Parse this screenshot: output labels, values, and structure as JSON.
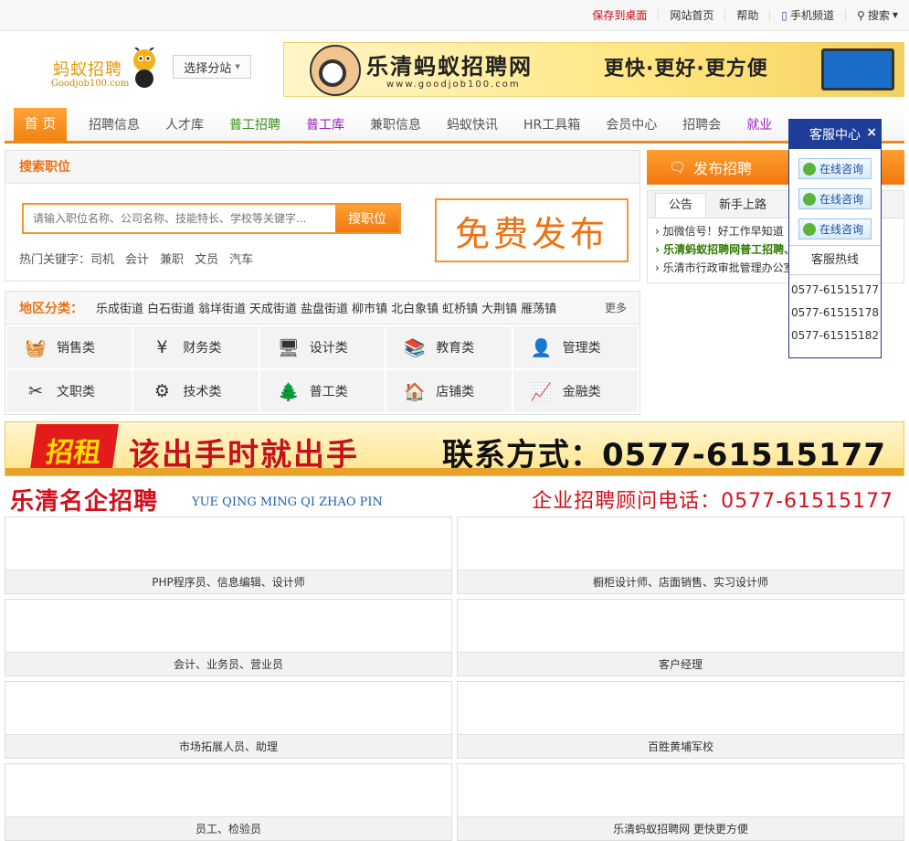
{
  "topbar": {
    "save_desktop": "保存到桌面",
    "home": "网站首页",
    "help": "帮助",
    "mobile": "手机频道",
    "search": "搜索"
  },
  "header": {
    "logo_text": "蚂蚁招聘",
    "logo_sub": "Goodjob100.com",
    "branch": "选择分站",
    "banner_title": "乐清蚂蚁招聘网",
    "banner_url": "www.goodjob100.com",
    "banner_slogan": "更快·更好·更方便"
  },
  "nav": [
    {
      "label": "首 页",
      "style": "home"
    },
    {
      "label": "招聘信息",
      "style": ""
    },
    {
      "label": "人才库",
      "style": ""
    },
    {
      "label": "普工招聘",
      "style": "green"
    },
    {
      "label": "普工库",
      "style": "purple"
    },
    {
      "label": "兼职信息",
      "style": ""
    },
    {
      "label": "蚂蚁快讯",
      "style": ""
    },
    {
      "label": "HR工具箱",
      "style": ""
    },
    {
      "label": "会员中心",
      "style": ""
    },
    {
      "label": "招聘会",
      "style": ""
    },
    {
      "label": "就业",
      "style": "purple"
    }
  ],
  "search": {
    "title": "搜索职位",
    "placeholder": "请输入职位名称、公司名称、技能特长、学校等关键字...",
    "button": "搜职位",
    "hot_label": "热门关键字：",
    "hot": [
      "司机",
      "会计",
      "兼职",
      "文员",
      "汽车"
    ],
    "free": "免费发布"
  },
  "area": {
    "title": "地区分类：",
    "districts": [
      "乐成街道",
      "白石街道",
      "翁垟街道",
      "天成街道",
      "盐盘街道",
      "柳市镇",
      "北白象镇",
      "虹桥镇",
      "大荆镇",
      "雁荡镇"
    ],
    "more": "更多"
  },
  "categories": [
    {
      "label": "销售类",
      "icon": "basket-icon",
      "glyph": "🧺"
    },
    {
      "label": "财务类",
      "icon": "money-icon",
      "glyph": "¥"
    },
    {
      "label": "设计类",
      "icon": "monitor-icon",
      "glyph": "🖥"
    },
    {
      "label": "教育类",
      "icon": "book-icon",
      "glyph": "📚"
    },
    {
      "label": "管理类",
      "icon": "person-icon",
      "glyph": "👤"
    },
    {
      "label": "文职类",
      "icon": "scissors-icon",
      "glyph": "✂"
    },
    {
      "label": "技术类",
      "icon": "gear-icon",
      "glyph": "⚙"
    },
    {
      "label": "普工类",
      "icon": "tree-icon",
      "glyph": "🌲"
    },
    {
      "label": "店铺类",
      "icon": "house-icon",
      "glyph": "🏠"
    },
    {
      "label": "金融类",
      "icon": "chart-icon",
      "glyph": "📈"
    }
  ],
  "post": {
    "label": "发布招聘"
  },
  "notice": {
    "tabs": [
      "公告",
      "新手上路"
    ],
    "items": [
      {
        "text": "加微信号！好工作早知道",
        "bold": false
      },
      {
        "text": "乐清蚂蚁招聘网普工招聘、",
        "bold": true
      },
      {
        "text": "乐清市行政审批管理办公室",
        "bold": false
      }
    ]
  },
  "service": {
    "title": "客服中心",
    "close": "×",
    "consult": [
      "在线咨询",
      "在线咨询",
      "在线咨询"
    ],
    "hotline_label": "客服热线",
    "phones": [
      "0577-61515177",
      "0577-61515178",
      "0577-61515182"
    ]
  },
  "ad": {
    "badge": "招租",
    "slogan": "该出手时就出手",
    "contact": "联系方式：0577-61515177"
  },
  "corp": {
    "title": "乐清名企招聘",
    "pinyin": "YUE QING MING QI ZHAO PIN",
    "phone": "企业招聘顾问电话：0577-61515177"
  },
  "jobs": [
    "PHP程序员、信息编辑、设计师",
    "橱柜设计师、店面销售、实习设计师",
    "会计、业务员、营业员",
    "客户经理",
    "市场拓展人员、助理",
    "百胜黄埔军校",
    "员工、检验员",
    "乐清蚂蚁招聘网 更快更方便"
  ]
}
